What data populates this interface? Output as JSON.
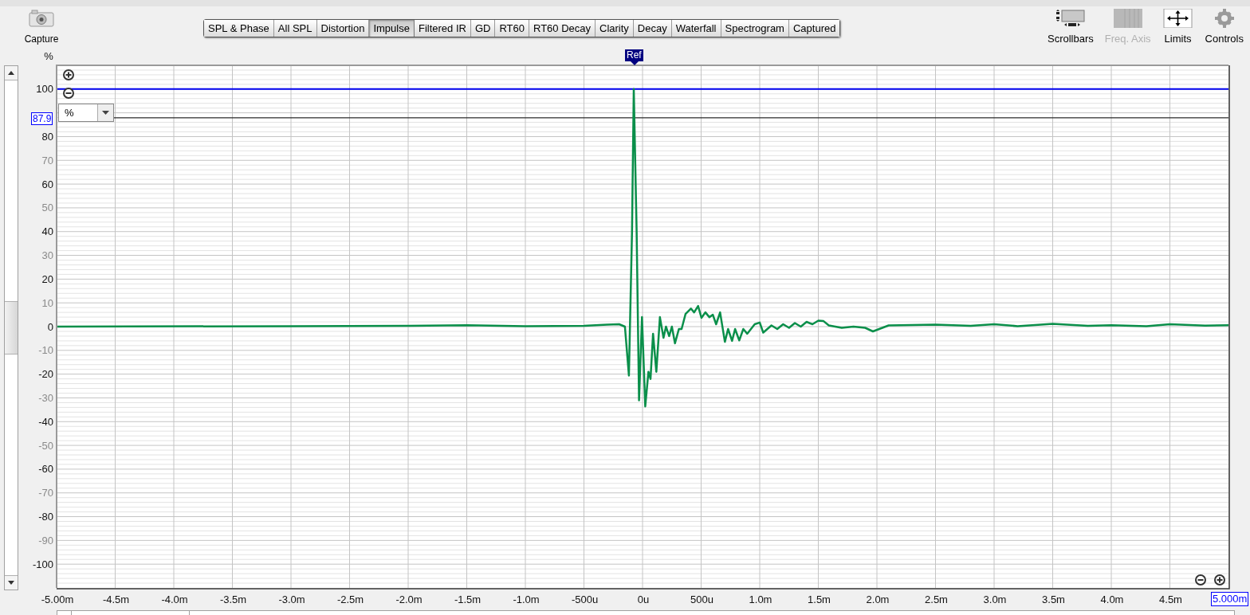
{
  "capture": {
    "label": "Capture"
  },
  "tabs": [
    {
      "label": "SPL & Phase",
      "selected": false
    },
    {
      "label": "All SPL",
      "selected": false
    },
    {
      "label": "Distortion",
      "selected": false
    },
    {
      "label": "Impulse",
      "selected": true
    },
    {
      "label": "Filtered IR",
      "selected": false
    },
    {
      "label": "GD",
      "selected": false
    },
    {
      "label": "RT60",
      "selected": false
    },
    {
      "label": "RT60 Decay",
      "selected": false
    },
    {
      "label": "Clarity",
      "selected": false
    },
    {
      "label": "Decay",
      "selected": false
    },
    {
      "label": "Waterfall",
      "selected": false
    },
    {
      "label": "Spectrogram",
      "selected": false
    },
    {
      "label": "Captured",
      "selected": false
    }
  ],
  "tools": [
    {
      "kind": "scrollbars",
      "label": "Scrollbars",
      "disabled": false
    },
    {
      "kind": "freq-axis",
      "label": "Freq. Axis",
      "disabled": true
    },
    {
      "kind": "limits",
      "label": "Limits",
      "disabled": false
    },
    {
      "kind": "controls",
      "label": "Controls",
      "disabled": false
    }
  ],
  "graph": {
    "unit_dropdown": {
      "value": "%"
    },
    "ref_marker": {
      "label": "Ref"
    },
    "cursor_readout": "87.9",
    "x_readout": "5.000m",
    "microsecond_tick_labels": [
      "-500u",
      "500u"
    ],
    "chart_data": {
      "type": "line",
      "ylabel": "%",
      "xlim": [
        -5,
        5
      ],
      "ylim": [
        -110,
        110
      ],
      "grid": true,
      "ref_lines": [
        {
          "axis": "y",
          "value": 100,
          "color": "#0000ee"
        },
        {
          "axis": "y",
          "value": 87.9,
          "color": "#000000"
        }
      ],
      "xticks": [
        {
          "value": -4.5,
          "label": "-4.5m"
        },
        {
          "value": -4,
          "label": "-4.0m"
        },
        {
          "value": -3.5,
          "label": "-3.5m"
        },
        {
          "value": -3,
          "label": "-3.0m"
        },
        {
          "value": -2.5,
          "label": "-2.5m"
        },
        {
          "value": -2,
          "label": "-2.0m"
        },
        {
          "value": -1.5,
          "label": "-1.5m"
        },
        {
          "value": -1,
          "label": "-1.0m"
        },
        {
          "value": 0,
          "label": "0u"
        },
        {
          "value": 1,
          "label": "1.0m"
        },
        {
          "value": 1.5,
          "label": "1.5m"
        },
        {
          "value": 2,
          "label": "2.0m"
        },
        {
          "value": 2.5,
          "label": "2.5m"
        },
        {
          "value": 3,
          "label": "3.0m"
        },
        {
          "value": 3.5,
          "label": "3.5m"
        },
        {
          "value": 4,
          "label": "4.0m"
        },
        {
          "value": 4.5,
          "label": "4.5m"
        },
        {
          "value": -5,
          "label": "-5.00m"
        }
      ],
      "yticks": [
        100,
        80,
        70,
        60,
        50,
        40,
        30,
        20,
        10,
        0,
        -10,
        -20,
        -30,
        -40,
        -50,
        -60,
        -70,
        -80,
        -90,
        -100
      ],
      "x": [
        -5,
        -3,
        -2,
        -1.5,
        -1,
        -0.5,
        -0.3,
        -0.2,
        -0.15,
        -0.116,
        -0.09,
        -0.075,
        -0.05,
        -0.03,
        -0.005,
        0.023,
        0.05,
        0.068,
        0.09,
        0.118,
        0.148,
        0.179,
        0.2,
        0.227,
        0.25,
        0.277,
        0.31,
        0.333,
        0.367,
        0.413,
        0.44,
        0.474,
        0.503,
        0.537,
        0.57,
        0.6,
        0.628,
        0.662,
        0.703,
        0.73,
        0.764,
        0.79,
        0.825,
        0.86,
        0.893,
        0.957,
        1.0,
        1.03,
        1.1,
        1.15,
        1.2,
        1.25,
        1.3,
        1.35,
        1.4,
        1.45,
        1.5,
        1.545,
        1.59,
        1.7,
        1.8,
        1.9,
        1.966,
        2.1,
        2.5,
        2.8,
        3.0,
        3.2,
        3.5,
        3.8,
        4.0,
        4.3,
        4.5,
        4.8,
        5.0
      ],
      "series": [
        {
          "color": "#0a8f4a",
          "values": [
            0,
            0.2,
            0.3,
            0.6,
            0.2,
            0.3,
            0.8,
            1,
            0,
            -20.6,
            40,
            100,
            40,
            -31,
            4,
            -33.6,
            -19,
            -22,
            -3,
            -19,
            4,
            -4.7,
            0,
            -4,
            0,
            -7,
            -1,
            -1,
            5.3,
            7.6,
            6,
            8.7,
            3.7,
            6,
            4,
            5,
            1,
            6,
            -6.4,
            -1,
            -6,
            -1,
            -5.8,
            -1,
            -3,
            1,
            1.7,
            -2.5,
            0.5,
            -1,
            1,
            -0.5,
            1.5,
            0,
            2,
            1,
            2.5,
            2.3,
            0.5,
            -0.5,
            0,
            -0.5,
            -2,
            0.5,
            0.8,
            0.3,
            1,
            0.2,
            1.2,
            0.3,
            0.6,
            0.2,
            1,
            0.4,
            0.6
          ]
        }
      ]
    }
  }
}
